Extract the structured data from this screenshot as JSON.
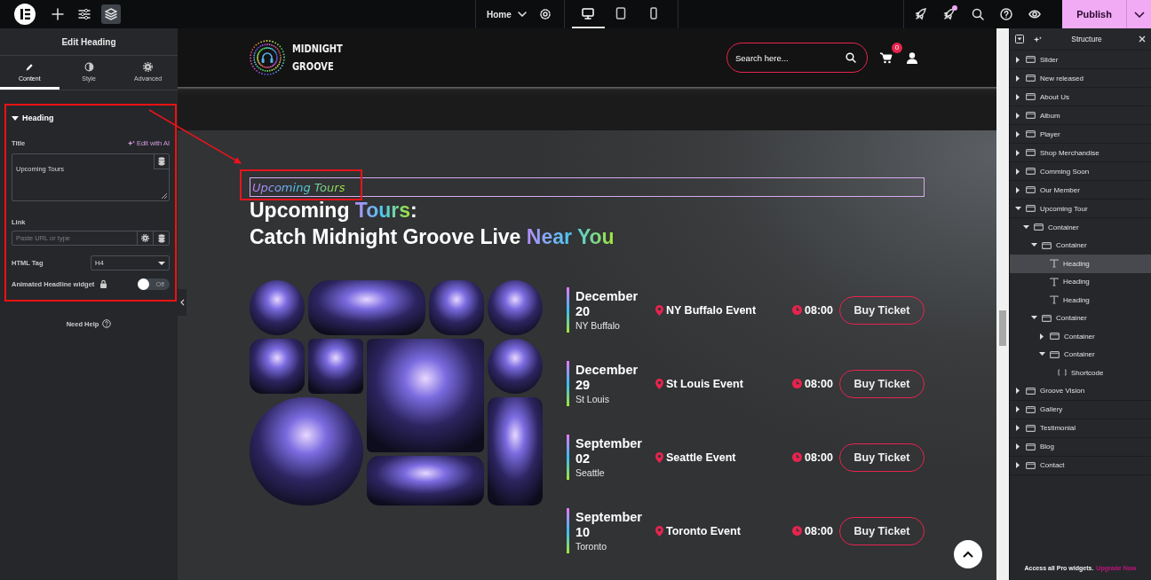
{
  "topbar": {
    "page": "Home",
    "devices": [
      {
        "kind": "desktop",
        "selected": true
      },
      {
        "kind": "tablet",
        "selected": false
      },
      {
        "kind": "mobile",
        "selected": false
      }
    ],
    "publish": "Publish"
  },
  "editor": {
    "title": "Edit Heading",
    "tabs": [
      {
        "label": "Content",
        "kind": "content",
        "selected": true
      },
      {
        "label": "Style",
        "kind": "style",
        "selected": false
      },
      {
        "label": "Advanced",
        "kind": "advanced",
        "selected": false
      }
    ],
    "section": {
      "title": "Heading",
      "expanded": true
    },
    "title_label": "Title",
    "ai_link": "Edit with AI",
    "title_value": "Upcoming Tours",
    "link_label": "Link",
    "link_placeholder": "Paste URL or type",
    "tag_label": "HTML Tag",
    "tag_value": "H4",
    "animated_label": "Animated Headline widget",
    "animated": {
      "on": false,
      "label": "Off"
    },
    "help": "Need Help"
  },
  "site": {
    "brand": [
      "MIDNIGHT",
      "GROOVE"
    ],
    "search_placeholder": "Search here...",
    "cart_count": "0",
    "subtitle": "Upcoming Tours",
    "heading": [
      {
        "parts": [
          {
            "text": "Upcoming ",
            "accent": false
          },
          {
            "text": "Tours",
            "accent": true
          },
          {
            "text": ":",
            "accent": false
          }
        ]
      },
      {
        "parts": [
          {
            "text": "Catch Midnight Groove Live ",
            "accent": false
          },
          {
            "text": "Near You",
            "accent": true
          }
        ]
      }
    ],
    "events": [
      {
        "month": "December",
        "day": "20",
        "city": "NY Buffalo",
        "name": "NY Buffalo Event",
        "time": "08:00",
        "button": "Buy Ticket"
      },
      {
        "month": "December",
        "day": "29",
        "city": "St Louis",
        "name": "St Louis Event",
        "time": "08:00",
        "button": "Buy Ticket"
      },
      {
        "month": "September",
        "day": "02",
        "city": "Seattle",
        "name": "Seattle Event",
        "time": "08:00",
        "button": "Buy Ticket"
      },
      {
        "month": "September",
        "day": "10",
        "city": "Toronto",
        "name": "Toronto Event",
        "time": "08:00",
        "button": "Buy Ticket"
      }
    ]
  },
  "structure": {
    "title": "Structure",
    "items": [
      {
        "label": "Slider",
        "kind": "container",
        "expanded": false,
        "selected": false
      },
      {
        "label": "New released",
        "kind": "container",
        "expanded": false,
        "selected": false
      },
      {
        "label": "About Us",
        "kind": "container",
        "expanded": false,
        "selected": false
      },
      {
        "label": "Album",
        "kind": "container",
        "expanded": false,
        "selected": false
      },
      {
        "label": "Player",
        "kind": "container",
        "expanded": false,
        "selected": false
      },
      {
        "label": "Shop Merchandise",
        "kind": "container",
        "expanded": false,
        "selected": false
      },
      {
        "label": "Comming Soon",
        "kind": "container",
        "expanded": false,
        "selected": false
      },
      {
        "label": "Our Member",
        "kind": "container",
        "expanded": false,
        "selected": false
      },
      {
        "label": "Upcoming Tour",
        "kind": "container",
        "expanded": true,
        "selected": false,
        "children": [
          {
            "label": "Container",
            "kind": "container",
            "expanded": true,
            "selected": false,
            "children": [
              {
                "label": "Container",
                "kind": "container",
                "expanded": true,
                "selected": false,
                "children": [
                  {
                    "label": "Heading",
                    "kind": "heading",
                    "selected": true
                  },
                  {
                    "label": "Heading",
                    "kind": "heading",
                    "selected": false
                  },
                  {
                    "label": "Heading",
                    "kind": "heading",
                    "selected": false
                  }
                ]
              },
              {
                "label": "Container",
                "kind": "container",
                "expanded": true,
                "selected": false,
                "children": [
                  {
                    "label": "Container",
                    "kind": "container",
                    "expanded": false,
                    "selected": false
                  },
                  {
                    "label": "Container",
                    "kind": "container",
                    "expanded": true,
                    "selected": false,
                    "children": [
                      {
                        "label": "Shortcode",
                        "kind": "shortcode",
                        "selected": false
                      }
                    ]
                  }
                ]
              }
            ]
          }
        ]
      },
      {
        "label": "Groove Vision",
        "kind": "container",
        "expanded": false,
        "selected": false
      },
      {
        "label": "Gallery",
        "kind": "container",
        "expanded": false,
        "selected": false
      },
      {
        "label": "Testimonial",
        "kind": "container",
        "expanded": false,
        "selected": false
      },
      {
        "label": "Blog",
        "kind": "container",
        "expanded": false,
        "selected": false
      },
      {
        "label": "Contact",
        "kind": "container",
        "expanded": false,
        "selected": false
      }
    ],
    "footer": "Access all Pro widgets.",
    "upgrade": "Upgrade Now"
  }
}
